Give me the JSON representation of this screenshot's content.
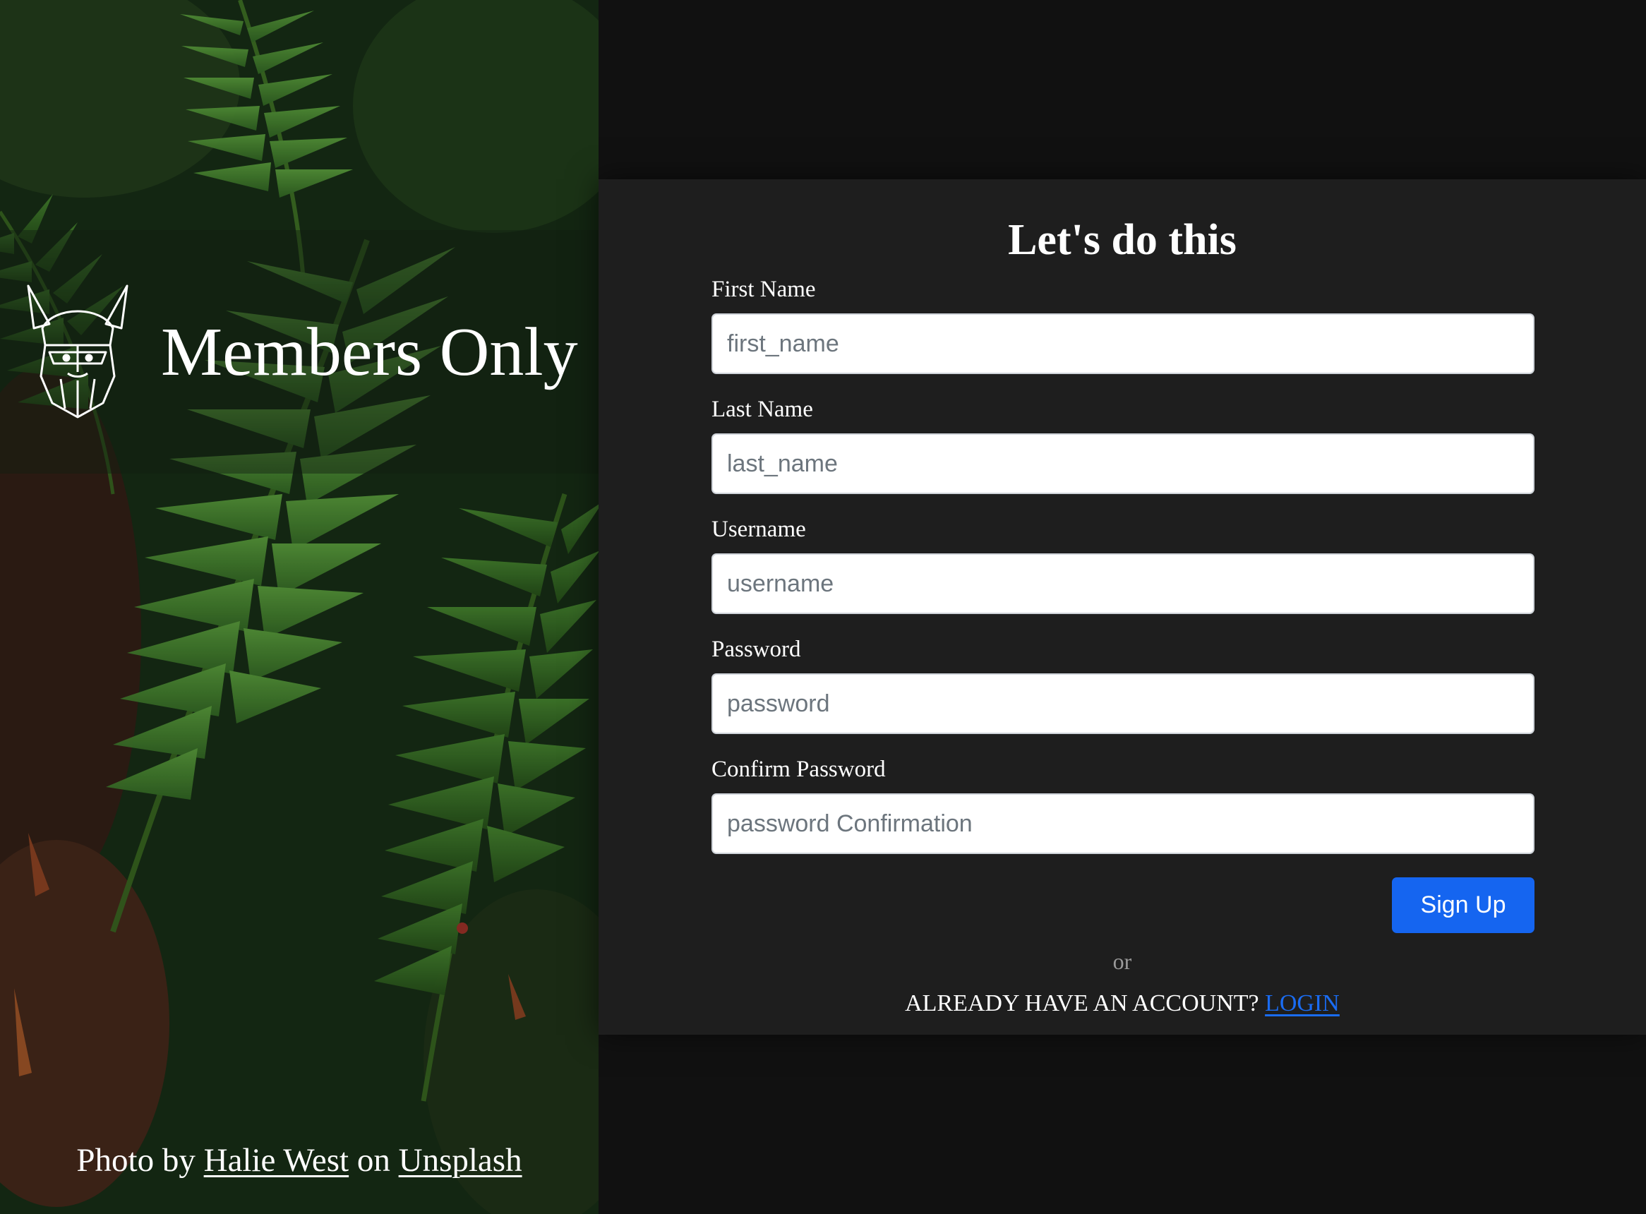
{
  "brand": {
    "title": "Members Only",
    "logo_icon": "viking-helmet-icon"
  },
  "photo_credit": {
    "prefix": "Photo by ",
    "author": "Halie West",
    "middle": " on ",
    "source": "Unsplash"
  },
  "form": {
    "heading": "Let's do this",
    "fields": [
      {
        "label": "First Name",
        "placeholder": "first_name",
        "value": ""
      },
      {
        "label": "Last Name",
        "placeholder": "last_name",
        "value": ""
      },
      {
        "label": "Username",
        "placeholder": "username",
        "value": ""
      },
      {
        "label": "Password",
        "placeholder": "password",
        "value": ""
      },
      {
        "label": "Confirm Password",
        "placeholder": "password Confirmation",
        "value": ""
      }
    ],
    "submit_label": "Sign Up",
    "or_text": "or",
    "account_prompt": "ALREADY HAVE AN ACCOUNT? ",
    "login_link": "LOGIN"
  },
  "colors": {
    "page_background": "#111111",
    "card_background": "#1e1e1e",
    "primary_button": "#1565f0",
    "link": "#1a6cf2"
  }
}
